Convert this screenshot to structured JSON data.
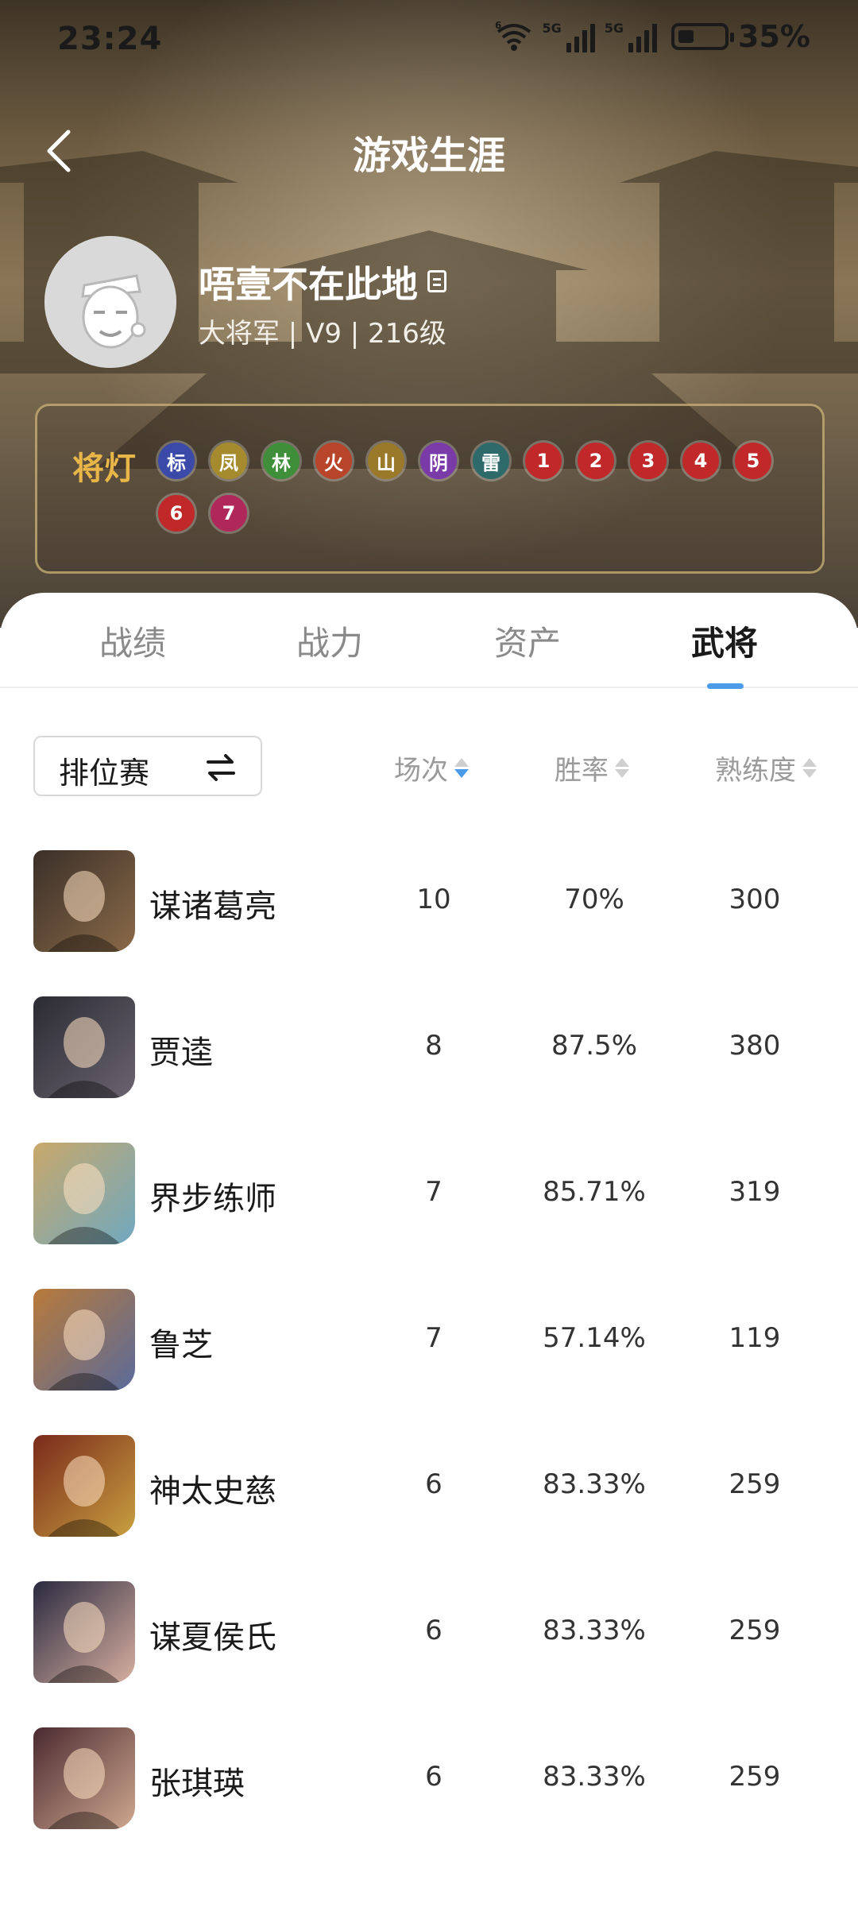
{
  "status_bar": {
    "time": "23:24",
    "wifi_badge": "6",
    "network_labels": [
      "5G",
      "5G"
    ],
    "battery_level": 0.35,
    "battery_text": "35%"
  },
  "header": {
    "title": "游戏生涯",
    "back_icon": "chevron-left-icon"
  },
  "profile": {
    "username": "唔壹不在此地",
    "meta": "大将军 | V9 | 216级",
    "copy_icon": "copy-icon"
  },
  "lamps": {
    "label": "将灯",
    "items": [
      {
        "glyph": "标",
        "color": "#3b4aa8"
      },
      {
        "glyph": "凤",
        "color": "#a58a2e"
      },
      {
        "glyph": "林",
        "color": "#3f8f3a"
      },
      {
        "glyph": "火",
        "color": "#b8442a"
      },
      {
        "glyph": "山",
        "color": "#9a7a2a"
      },
      {
        "glyph": "阴",
        "color": "#7a3aa8"
      },
      {
        "glyph": "雷",
        "color": "#2f6a6a"
      },
      {
        "glyph": "1",
        "color": "#c0282a"
      },
      {
        "glyph": "2",
        "color": "#c0282a"
      },
      {
        "glyph": "3",
        "color": "#c0282a"
      },
      {
        "glyph": "4",
        "color": "#c0282a"
      },
      {
        "glyph": "5",
        "color": "#c0282a"
      },
      {
        "glyph": "6",
        "color": "#c0282a"
      },
      {
        "glyph": "7",
        "color": "#b0285a"
      }
    ]
  },
  "tabs": [
    "战绩",
    "战力",
    "资产",
    "武将"
  ],
  "active_tab": "武将",
  "filter": {
    "mode": "排位赛"
  },
  "columns": {
    "matches": "场次",
    "win_rate": "胜率",
    "proficiency": "熟练度"
  },
  "generals": [
    {
      "name": "谋诸葛亮",
      "matches": "10",
      "win_rate": "70%",
      "proficiency": "300",
      "tone": [
        "#3a2f28",
        "#8a6a48"
      ]
    },
    {
      "name": "贾逵",
      "matches": "8",
      "win_rate": "87.5%",
      "proficiency": "380",
      "tone": [
        "#2b2b33",
        "#6a6470"
      ]
    },
    {
      "name": "界步练师",
      "matches": "7",
      "win_rate": "85.71%",
      "proficiency": "319",
      "tone": [
        "#c9a86a",
        "#6fa8c0"
      ]
    },
    {
      "name": "鲁芝",
      "matches": "7",
      "win_rate": "57.14%",
      "proficiency": "119",
      "tone": [
        "#b87a3a",
        "#5a6a9a"
      ]
    },
    {
      "name": "神太史慈",
      "matches": "6",
      "win_rate": "83.33%",
      "proficiency": "259",
      "tone": [
        "#7a2a1a",
        "#c8a040"
      ]
    },
    {
      "name": "谋夏侯氏",
      "matches": "6",
      "win_rate": "83.33%",
      "proficiency": "259",
      "tone": [
        "#2a2a40",
        "#d8b0a0"
      ]
    },
    {
      "name": "张琪瑛",
      "matches": "6",
      "win_rate": "83.33%",
      "proficiency": "259",
      "tone": [
        "#4a2a30",
        "#d0a890"
      ]
    }
  ]
}
